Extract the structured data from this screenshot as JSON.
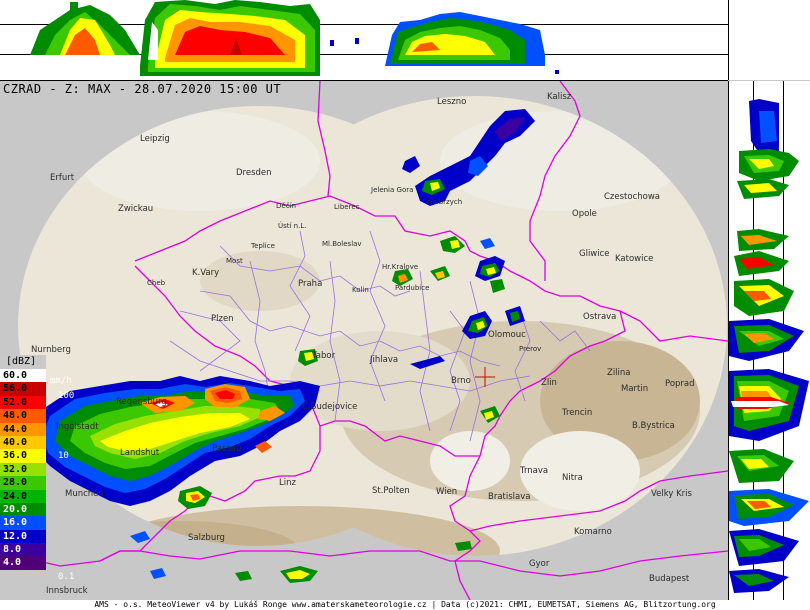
{
  "title": "CZRAD - Z: MAX - 28.07.2020 15:00 UT",
  "footer": "AMS - o.s. MeteoViewer v4 by Lukáš Ronge www.amaterskameteorologie.cz | Data (c)2021: CHMI, EUMETSAT, Siemens AG, Blitzortung.org",
  "legend": {
    "unit": "[dBZ]",
    "rate_unit": "mm/h",
    "levels": [
      {
        "label": "60.0",
        "color": "#ffffff",
        "text": "#000000"
      },
      {
        "label": "56.0",
        "color": "#c80000",
        "text": "#000000"
      },
      {
        "label": "52.0",
        "color": "#ff0000",
        "text": "#000000"
      },
      {
        "label": "48.0",
        "color": "#ff5a00",
        "text": "#000000"
      },
      {
        "label": "44.0",
        "color": "#ff9600",
        "text": "#000000"
      },
      {
        "label": "40.0",
        "color": "#ffc800",
        "text": "#000000"
      },
      {
        "label": "36.0",
        "color": "#ffff00",
        "text": "#000000"
      },
      {
        "label": "32.0",
        "color": "#96e100",
        "text": "#000000"
      },
      {
        "label": "28.0",
        "color": "#3cc800",
        "text": "#000000"
      },
      {
        "label": "24.0",
        "color": "#00b400",
        "text": "#000000"
      },
      {
        "label": "20.0",
        "color": "#008c00",
        "text": "#ffffff"
      },
      {
        "label": "16.0",
        "color": "#0050ff",
        "text": "#ffffff"
      },
      {
        "label": "12.0",
        "color": "#0000c8",
        "text": "#ffffff"
      },
      {
        "label": "8.0",
        "color": "#3c00a0",
        "text": "#ffffff"
      },
      {
        "label": "4.0",
        "color": "#500078",
        "text": "#ffffff"
      }
    ],
    "rates": [
      "100",
      "10",
      "0.1"
    ]
  },
  "cities": [
    {
      "name": "Leszno",
      "small": false
    },
    {
      "name": "Kalisz",
      "small": false
    },
    {
      "name": "Leipzig",
      "small": false
    },
    {
      "name": "Dresden",
      "small": false
    },
    {
      "name": "Erfurt",
      "small": false
    },
    {
      "name": "Jelenia Gora",
      "small": true
    },
    {
      "name": "Walbrzych",
      "small": true
    },
    {
      "name": "Czestochowa",
      "small": false
    },
    {
      "name": "Opole",
      "small": false
    },
    {
      "name": "Zwickau",
      "small": false
    },
    {
      "name": "Děčín",
      "small": true
    },
    {
      "name": "Liberec",
      "small": true
    },
    {
      "name": "Ústí n.L.",
      "small": true
    },
    {
      "name": "Teplice",
      "small": true
    },
    {
      "name": "Most",
      "small": true
    },
    {
      "name": "Ml.Boleslav",
      "small": true
    },
    {
      "name": "Gliwice",
      "small": false
    },
    {
      "name": "Katowice",
      "small": false
    },
    {
      "name": "K.Vary",
      "small": false
    },
    {
      "name": "Cheb",
      "small": true
    },
    {
      "name": "Praha",
      "small": false
    },
    {
      "name": "Hr.Kralove",
      "small": true
    },
    {
      "name": "Pardubice",
      "small": true
    },
    {
      "name": "Kolin",
      "small": true
    },
    {
      "name": "Ostrava",
      "small": false
    },
    {
      "name": "Plzen",
      "small": false
    },
    {
      "name": "Nurnberg",
      "small": false
    },
    {
      "name": "Olomouc",
      "small": false
    },
    {
      "name": "Prerov",
      "small": true
    },
    {
      "name": "Tabor",
      "small": false
    },
    {
      "name": "Jihlava",
      "small": false
    },
    {
      "name": "Zilina",
      "small": false
    },
    {
      "name": "Martin",
      "small": false
    },
    {
      "name": "Poprad",
      "small": false
    },
    {
      "name": "Brno",
      "small": false
    },
    {
      "name": "Zlin",
      "small": false
    },
    {
      "name": "Regensburg",
      "small": false
    },
    {
      "name": "C.Budejovice",
      "small": false
    },
    {
      "name": "Trencin",
      "small": false
    },
    {
      "name": "Ingolstadt",
      "small": false
    },
    {
      "name": "B.Bystrica",
      "small": false
    },
    {
      "name": "Landshut",
      "small": false
    },
    {
      "name": "Passau",
      "small": false
    },
    {
      "name": "Trnava",
      "small": false
    },
    {
      "name": "Nitra",
      "small": false
    },
    {
      "name": "Linz",
      "small": false
    },
    {
      "name": "Munchen",
      "small": false
    },
    {
      "name": "St.Polten",
      "small": false
    },
    {
      "name": "Wien",
      "small": false
    },
    {
      "name": "Bratislava",
      "small": false
    },
    {
      "name": "Velky Kris",
      "small": false
    },
    {
      "name": "Komarno",
      "small": false
    },
    {
      "name": "Salzburg",
      "small": false
    },
    {
      "name": "Gyor",
      "small": false
    },
    {
      "name": "Budapest",
      "small": false
    },
    {
      "name": "Innsbruck",
      "small": false
    }
  ]
}
